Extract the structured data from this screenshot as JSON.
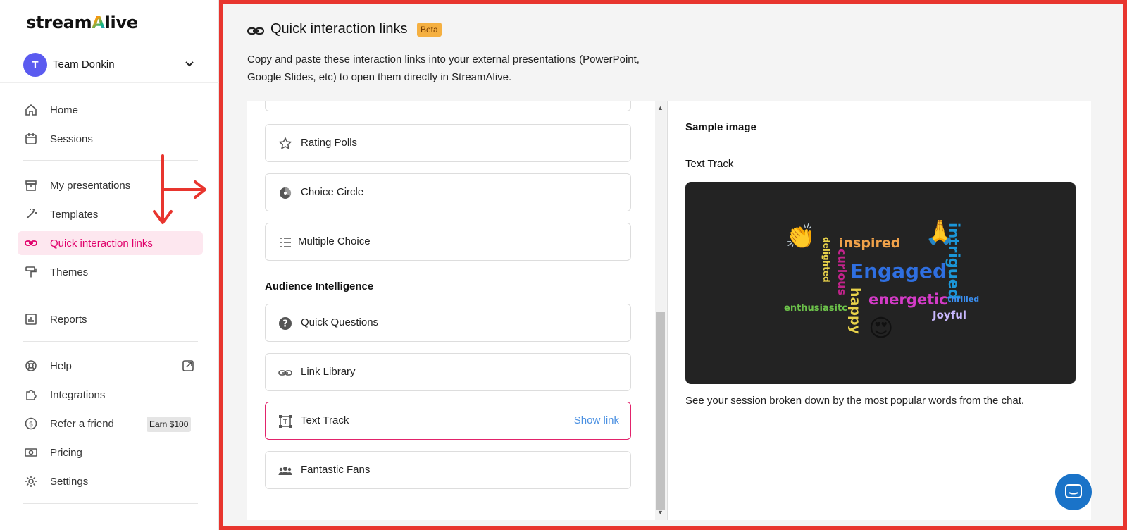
{
  "brand": {
    "logo_pre": "stream",
    "logo_a": "A",
    "logo_post": "live"
  },
  "team": {
    "initial": "T",
    "name": "Team Donkin"
  },
  "nav": {
    "home": "Home",
    "sessions": "Sessions",
    "my_presentations": "My presentations",
    "templates": "Templates",
    "quick_links": "Quick interaction links",
    "themes": "Themes",
    "reports": "Reports",
    "help": "Help",
    "integrations": "Integrations",
    "refer": "Refer a friend",
    "earn_badge": "Earn $100",
    "pricing": "Pricing",
    "settings": "Settings"
  },
  "header": {
    "title": "Quick interaction links",
    "badge": "Beta",
    "description": "Copy and paste these interaction links into your external presentations (PowerPoint, Google Slides, etc) to open them directly in StreamAlive."
  },
  "list": {
    "items_top": [
      {
        "label": "Rating Polls",
        "icon": "star-icon"
      },
      {
        "label": "Choice Circle",
        "icon": "pie-icon"
      },
      {
        "label": "Multiple Choice",
        "icon": "list-icon"
      }
    ],
    "section": "Audience Intelligence",
    "items_bottom": [
      {
        "label": "Quick Questions",
        "icon": "question-icon"
      },
      {
        "label": "Link Library",
        "icon": "link-icon"
      },
      {
        "label": "Text Track",
        "icon": "text-frame-icon",
        "action": "Show link"
      },
      {
        "label": "Fantastic Fans",
        "icon": "group-icon"
      }
    ]
  },
  "preview": {
    "sample_label": "Sample image",
    "title": "Text Track",
    "caption": "See your session broken down by the most popular words from the chat.",
    "words": {
      "inspired": "inspired",
      "curious": "curious",
      "delighted": "delighted",
      "intrigued": "intrigued",
      "engaged": "Engaged",
      "energetic": "energetic",
      "happy": "happy",
      "enthusiastic": "enthusiasitc",
      "thrilled": "thrilled",
      "joyful": "Joyful"
    }
  },
  "colors": {
    "accent": "#e0006b",
    "annotation_red": "#e8352e",
    "link_blue": "#4a90e2",
    "beta_orange": "#f5b041"
  }
}
